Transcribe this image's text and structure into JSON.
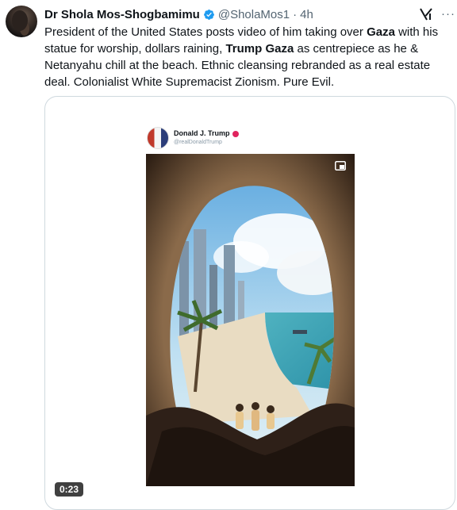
{
  "author": {
    "name": "Dr Shola Mos-Shogbamimu",
    "handle": "@SholaMos1",
    "separator": "·",
    "time": "4h",
    "verified": true
  },
  "post": {
    "segments": [
      {
        "text": "President of the United States posts video of him taking over ",
        "bold": false
      },
      {
        "text": "Gaza",
        "bold": true
      },
      {
        "text": " with his statue for worship, dollars raining, ",
        "bold": false
      },
      {
        "text": "Trump Gaza",
        "bold": true
      },
      {
        "text": " as centrepiece as he & Netanyahu chill at the beach. Ethnic cleansing rebranded as a real estate deal. Colonialist White Supremacist Zionism. Pure Evil.",
        "bold": false
      }
    ]
  },
  "media": {
    "embedded_author": "Donald J. Trump",
    "embedded_handle": "@realDonaldTrump",
    "duration": "0:23"
  },
  "icons": {
    "verified": "verified-badge-icon",
    "grok": "grok-icon",
    "more": "more-icon",
    "pip": "picture-in-picture-icon"
  },
  "colors": {
    "verified": "#1d9bf0",
    "text": "#0f1419",
    "muted": "#536471",
    "border": "#cfd9de"
  }
}
